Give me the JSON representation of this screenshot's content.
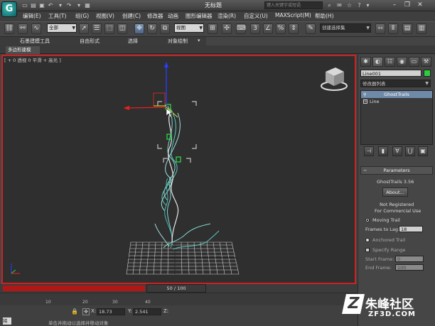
{
  "titlebar": {
    "app_logo": "G",
    "title": "无标题",
    "search_placeholder": "键入关键字或短语"
  },
  "menubar": {
    "items": [
      "编辑(E)",
      "工具(T)",
      "组(G)",
      "视图(V)",
      "创建(C)",
      "修改器",
      "动画",
      "图形编辑器",
      "渲染(R)",
      "自定义(U)",
      "MAXScript(M)",
      "帮助(H)"
    ]
  },
  "toolbar": {
    "selection_filter": "全部",
    "ref_coord": "视图",
    "named_selection": "创建选择集"
  },
  "ribbon": {
    "tabs": [
      "石墨建模工具",
      "自由形式",
      "选择",
      "对象绘制"
    ],
    "sub_tab": "多边形建模"
  },
  "viewport": {
    "label": "[ + 0 透视 0 平滑 + 高光 ]"
  },
  "cmdpanel": {
    "tabs": [
      "create",
      "modify",
      "hierarchy",
      "motion",
      "display",
      "utilities"
    ],
    "object_name": "Line001",
    "object_color": "#2ecc40",
    "modifier_list": "修改器列表",
    "stack_selected": "GhostTrails",
    "stack_item": "Line",
    "rollout_title": "Parameters",
    "plugin_version": "GhostTrails 3.56",
    "about_label": "About...",
    "reg_line1": "Not Registered",
    "reg_line2": "For Commercial Use",
    "moving_trail": "Moving Trail",
    "frames_to_lag_label": "Frames to Lag:",
    "frames_to_lag_value": "18",
    "anchored_trail": "Anchored Trail",
    "specify_range": "Specify Range",
    "start_frame_label": "Start Frame:",
    "start_frame_value": "0",
    "end_frame_label": "End Frame:",
    "end_frame_value": "100"
  },
  "timeline": {
    "position": "50 / 100",
    "position_fraction": 0.5,
    "ticks": [
      "10",
      "20",
      "30",
      "40"
    ]
  },
  "status": {
    "x_label": "X:",
    "x_value": "18.73",
    "y_label": "Y:",
    "y_value": "2.541",
    "z_label": "Z:",
    "message": "单击并拖动以选择并移动对象",
    "left_text": "将"
  },
  "watermark": {
    "brand_cn": "朱峰社区",
    "brand_url": "ZF3D.COM"
  }
}
